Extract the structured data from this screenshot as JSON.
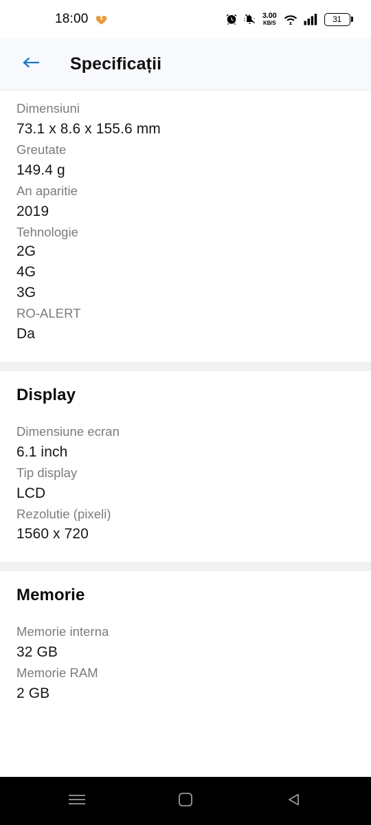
{
  "statusbar": {
    "time": "18:00",
    "heart_icon": "heart-icon",
    "alarm_icon": "alarm-clock-icon",
    "mute_icon": "bell-muted-icon",
    "netspeed_value": "3.00",
    "netspeed_unit": "KB/S",
    "wifi_icon": "wifi-icon",
    "signal_icon": "cellular-signal-icon",
    "battery_level": "31",
    "heart_color": "#eb9a3c"
  },
  "appbar": {
    "back_icon": "arrow-left-icon",
    "back_color": "#1878c8",
    "title": "Specificații"
  },
  "sections": [
    {
      "title": null,
      "rows": [
        {
          "label": "Dimensiuni",
          "value": "73.1 x 8.6 x 155.6 mm"
        },
        {
          "label": "Greutate",
          "value": "149.4 g"
        },
        {
          "label": "An aparitie",
          "value": "2019"
        },
        {
          "label": "Tehnologie",
          "value": "2G\n4G\n3G"
        },
        {
          "label": "RO-ALERT",
          "value": "Da"
        }
      ]
    },
    {
      "title": "Display",
      "rows": [
        {
          "label": "Dimensiune ecran",
          "value": "6.1 inch"
        },
        {
          "label": "Tip display",
          "value": "LCD"
        },
        {
          "label": "Rezolutie (pixeli)",
          "value": "1560 x 720"
        }
      ]
    },
    {
      "title": "Memorie",
      "rows": [
        {
          "label": "Memorie interna",
          "value": "32 GB"
        },
        {
          "label": "Memorie RAM",
          "value": "2 GB"
        }
      ]
    }
  ],
  "navbar": {
    "recents_icon": "menu-lines-icon",
    "home_icon": "home-square-icon",
    "back_icon": "back-triangle-icon"
  }
}
